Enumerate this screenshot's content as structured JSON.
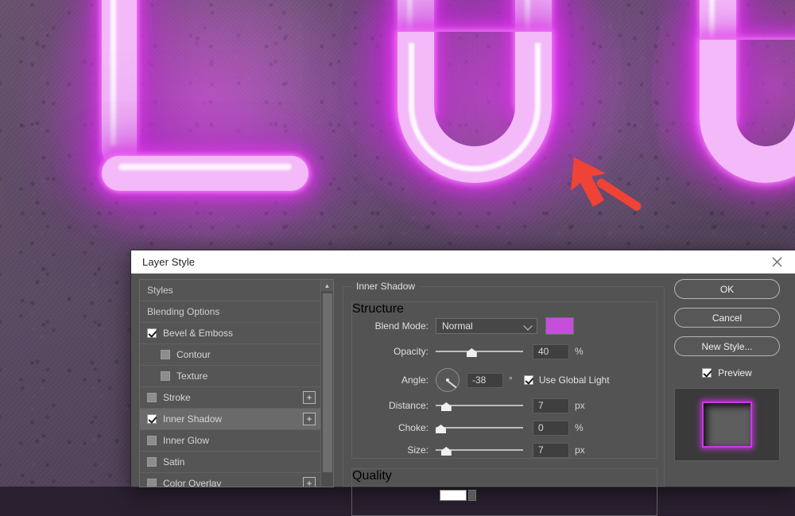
{
  "background": {
    "scene": "neon-sign-photo",
    "neon_color": "#ee6ff5",
    "wall_color": "#5e4d66",
    "annotation_arrow_color": "#ef4335"
  },
  "dialog": {
    "title": "Layer Style",
    "close_icon": "close-icon"
  },
  "styles_list": {
    "scroll_up_icon": "chevron-up-icon",
    "items": [
      {
        "label": "Styles",
        "type": "plain",
        "checked": null,
        "selected": false,
        "indent": false,
        "plus": false
      },
      {
        "label": "Blending Options",
        "type": "plain",
        "checked": null,
        "selected": false,
        "indent": false,
        "plus": false
      },
      {
        "label": "Bevel & Emboss",
        "type": "checkbox",
        "checked": true,
        "selected": false,
        "indent": false,
        "plus": false
      },
      {
        "label": "Contour",
        "type": "checkbox",
        "checked": false,
        "selected": false,
        "indent": true,
        "plus": false
      },
      {
        "label": "Texture",
        "type": "checkbox",
        "checked": false,
        "selected": false,
        "indent": true,
        "plus": false
      },
      {
        "label": "Stroke",
        "type": "checkbox",
        "checked": false,
        "selected": false,
        "indent": false,
        "plus": true
      },
      {
        "label": "Inner Shadow",
        "type": "checkbox",
        "checked": true,
        "selected": true,
        "indent": false,
        "plus": true
      },
      {
        "label": "Inner Glow",
        "type": "checkbox",
        "checked": false,
        "selected": false,
        "indent": false,
        "plus": false
      },
      {
        "label": "Satin",
        "type": "checkbox",
        "checked": false,
        "selected": false,
        "indent": false,
        "plus": false
      },
      {
        "label": "Color Overlay",
        "type": "checkbox",
        "checked": false,
        "selected": false,
        "indent": false,
        "plus": true
      }
    ],
    "plus_label": "+"
  },
  "options": {
    "section_title": "Inner Shadow",
    "structure_title": "Structure",
    "quality_title": "Quality",
    "blend_mode": {
      "label": "Blend Mode:",
      "value": "Normal",
      "color_swatch": "#c44fda"
    },
    "opacity": {
      "label": "Opacity:",
      "value": "40",
      "unit": "%",
      "slider_pct": 40
    },
    "angle": {
      "label": "Angle:",
      "value": "-38",
      "unit": "°",
      "global_light_label": "Use Global Light",
      "global_light_checked": true
    },
    "distance": {
      "label": "Distance:",
      "value": "7",
      "unit": "px",
      "slider_pct": 7
    },
    "choke": {
      "label": "Choke:",
      "value": "0",
      "unit": "%",
      "slider_pct": 0
    },
    "size": {
      "label": "Size:",
      "value": "7",
      "unit": "px",
      "slider_pct": 7
    }
  },
  "buttons": {
    "ok": "OK",
    "cancel": "Cancel",
    "new_style": "New Style...",
    "preview_label": "Preview",
    "preview_checked": true
  }
}
